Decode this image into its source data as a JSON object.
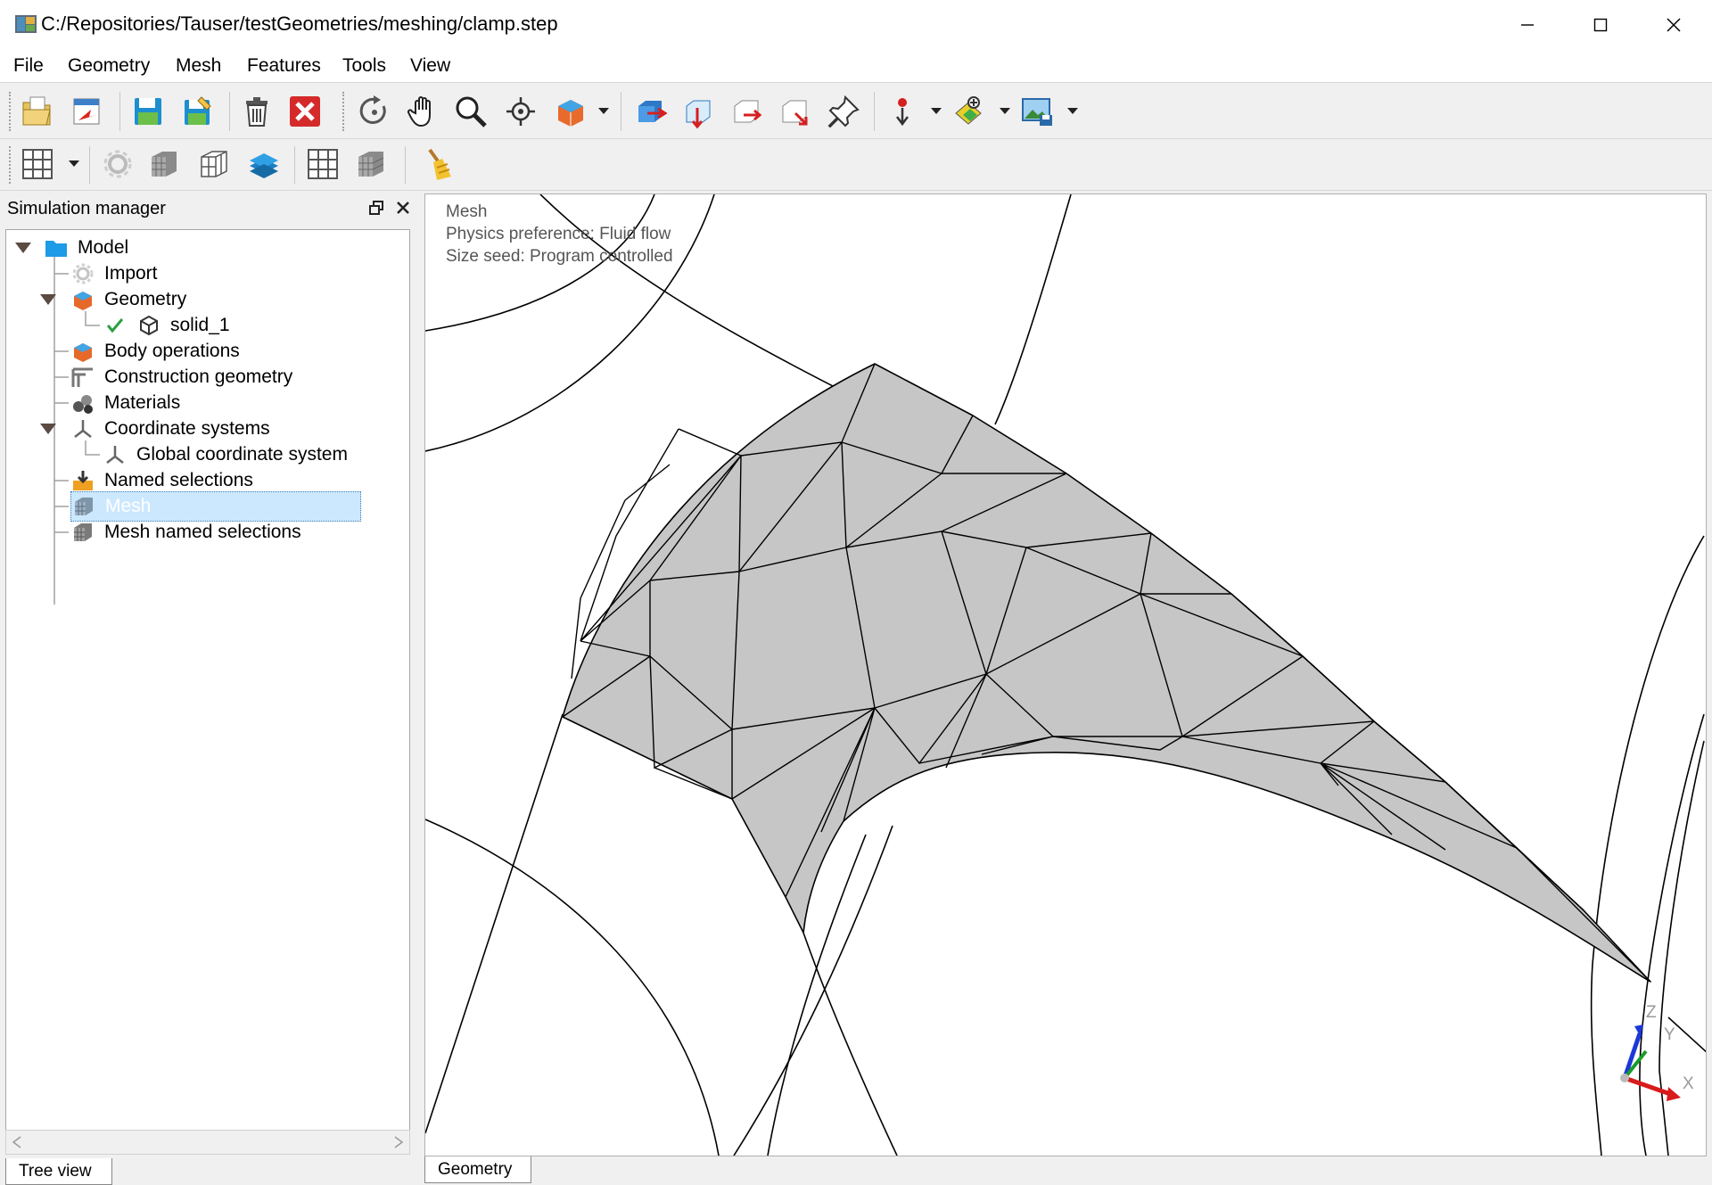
{
  "window": {
    "title": "C:/Repositories/Tauser/testGeometries/meshing/clamp.step",
    "minimize_icon": "minimize-icon",
    "maximize_icon": "maximize-icon",
    "close_icon": "close-icon"
  },
  "menu": [
    "File",
    "Geometry",
    "Mesh",
    "Features",
    "Tools",
    "View"
  ],
  "toolbar1": [
    "open-file-icon",
    "import-icon",
    "save-icon",
    "save-as-icon",
    "delete-icon",
    "close-model-icon",
    "rotate-icon",
    "pan-icon",
    "zoom-icon",
    "fit-view-icon",
    "display-style-icon",
    "view-front-icon",
    "view-top-icon",
    "view-side-icon",
    "view-iso-icon",
    "pin-icon",
    "pick-icon",
    "selection-filter-icon",
    "screenshot-icon"
  ],
  "toolbar2": [
    "mesh-grid-icon",
    "mesh-settings-icon",
    "mesh-solid-icon",
    "mesh-wire-icon",
    "mesh-layers-icon",
    "mesh-surface-icon",
    "mesh-volume-icon",
    "clean-icon"
  ],
  "dock": {
    "title": "Simulation manager",
    "float_icon": "float-icon",
    "close_icon": "close-icon"
  },
  "tree": {
    "items": [
      {
        "label": "Model",
        "icon": "folder-icon"
      },
      {
        "label": "Import",
        "icon": "gear-icon"
      },
      {
        "label": "Geometry",
        "icon": "geometry-icon"
      },
      {
        "label": "solid_1",
        "icon": "solid-cube-icon"
      },
      {
        "label": "Body operations",
        "icon": "body-operations-icon"
      },
      {
        "label": "Construction geometry",
        "icon": "construction-icon"
      },
      {
        "label": "Materials",
        "icon": "materials-icon"
      },
      {
        "label": "Coordinate systems",
        "icon": "axes-icon"
      },
      {
        "label": "Global coordinate system",
        "icon": "axes-icon"
      },
      {
        "label": "Named selections",
        "icon": "named-selection-icon"
      },
      {
        "label": "Mesh",
        "icon": "mesh-icon"
      },
      {
        "label": "Mesh named selections",
        "icon": "mesh-selection-icon"
      }
    ]
  },
  "tabs": {
    "left": "Tree view",
    "viewport": "Geometry"
  },
  "viewport_info": {
    "line1": "Mesh",
    "line2": "Physics preference: Fluid flow",
    "line3": "Size seed: Program controlled"
  },
  "axes": {
    "x": "X",
    "y": "Y",
    "z": "Z",
    "x_color": "#d81b1b",
    "y_color": "#1a9c2a",
    "z_color": "#1c38d8"
  },
  "colors": {
    "mesh_face": "#c6c6c6",
    "selection": "#cce8ff"
  }
}
